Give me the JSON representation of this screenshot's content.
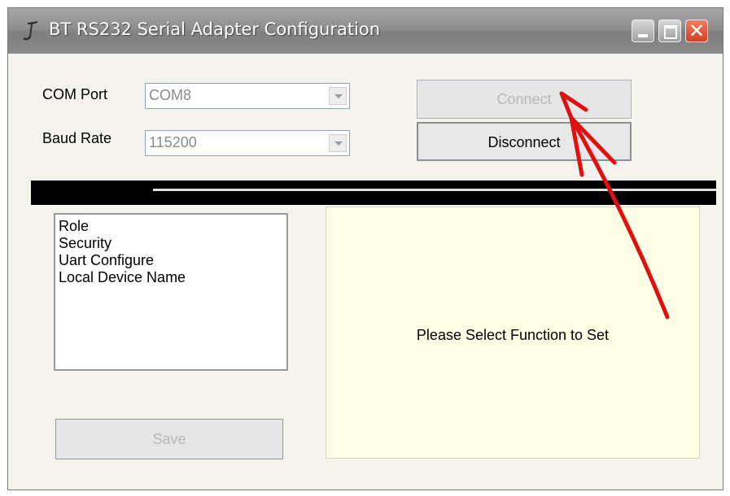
{
  "window": {
    "title": "BT RS232 Serial Adapter Configuration",
    "close_glyph": "✕"
  },
  "connection": {
    "com_port_label": "COM Port",
    "com_port_value": "COM8",
    "baud_rate_label": "Baud Rate",
    "baud_rate_value": "115200",
    "connect_label": "Connect",
    "disconnect_label": "Disconnect"
  },
  "functions": {
    "items": [
      "Role",
      "Security",
      "Uart Configure",
      "Local Device Name"
    ],
    "save_label": "Save"
  },
  "panel": {
    "message": "Please Select Function to Set"
  },
  "colors": {
    "annotation_arrow": "#e01010",
    "panel_background": "#ffffe6"
  }
}
